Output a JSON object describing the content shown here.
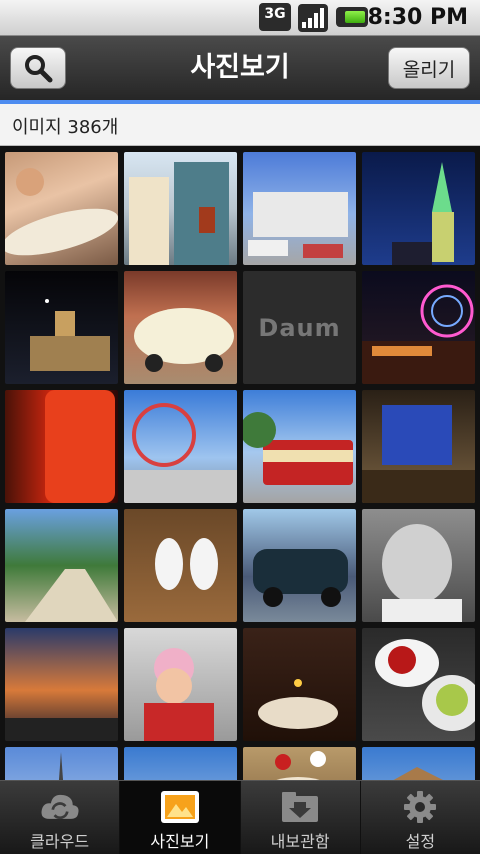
{
  "status_bar": {
    "network": "3G",
    "time": "8:30 PM"
  },
  "header": {
    "title": "사진보기",
    "upload_label": "올리기"
  },
  "gallery": {
    "count_text": "이미지 386개",
    "placeholder_brand": "Daum"
  },
  "tabs": [
    {
      "label": "클라우드",
      "icon": "cloud-sync-icon"
    },
    {
      "label": "사진보기",
      "icon": "photo-icon"
    },
    {
      "label": "내보관함",
      "icon": "download-box-icon"
    },
    {
      "label": "설정",
      "icon": "gear-icon"
    }
  ],
  "colors": {
    "accent": "#4d8cf0",
    "header_bg": "#333333",
    "photo_icon_orange": "#f7a21b"
  }
}
